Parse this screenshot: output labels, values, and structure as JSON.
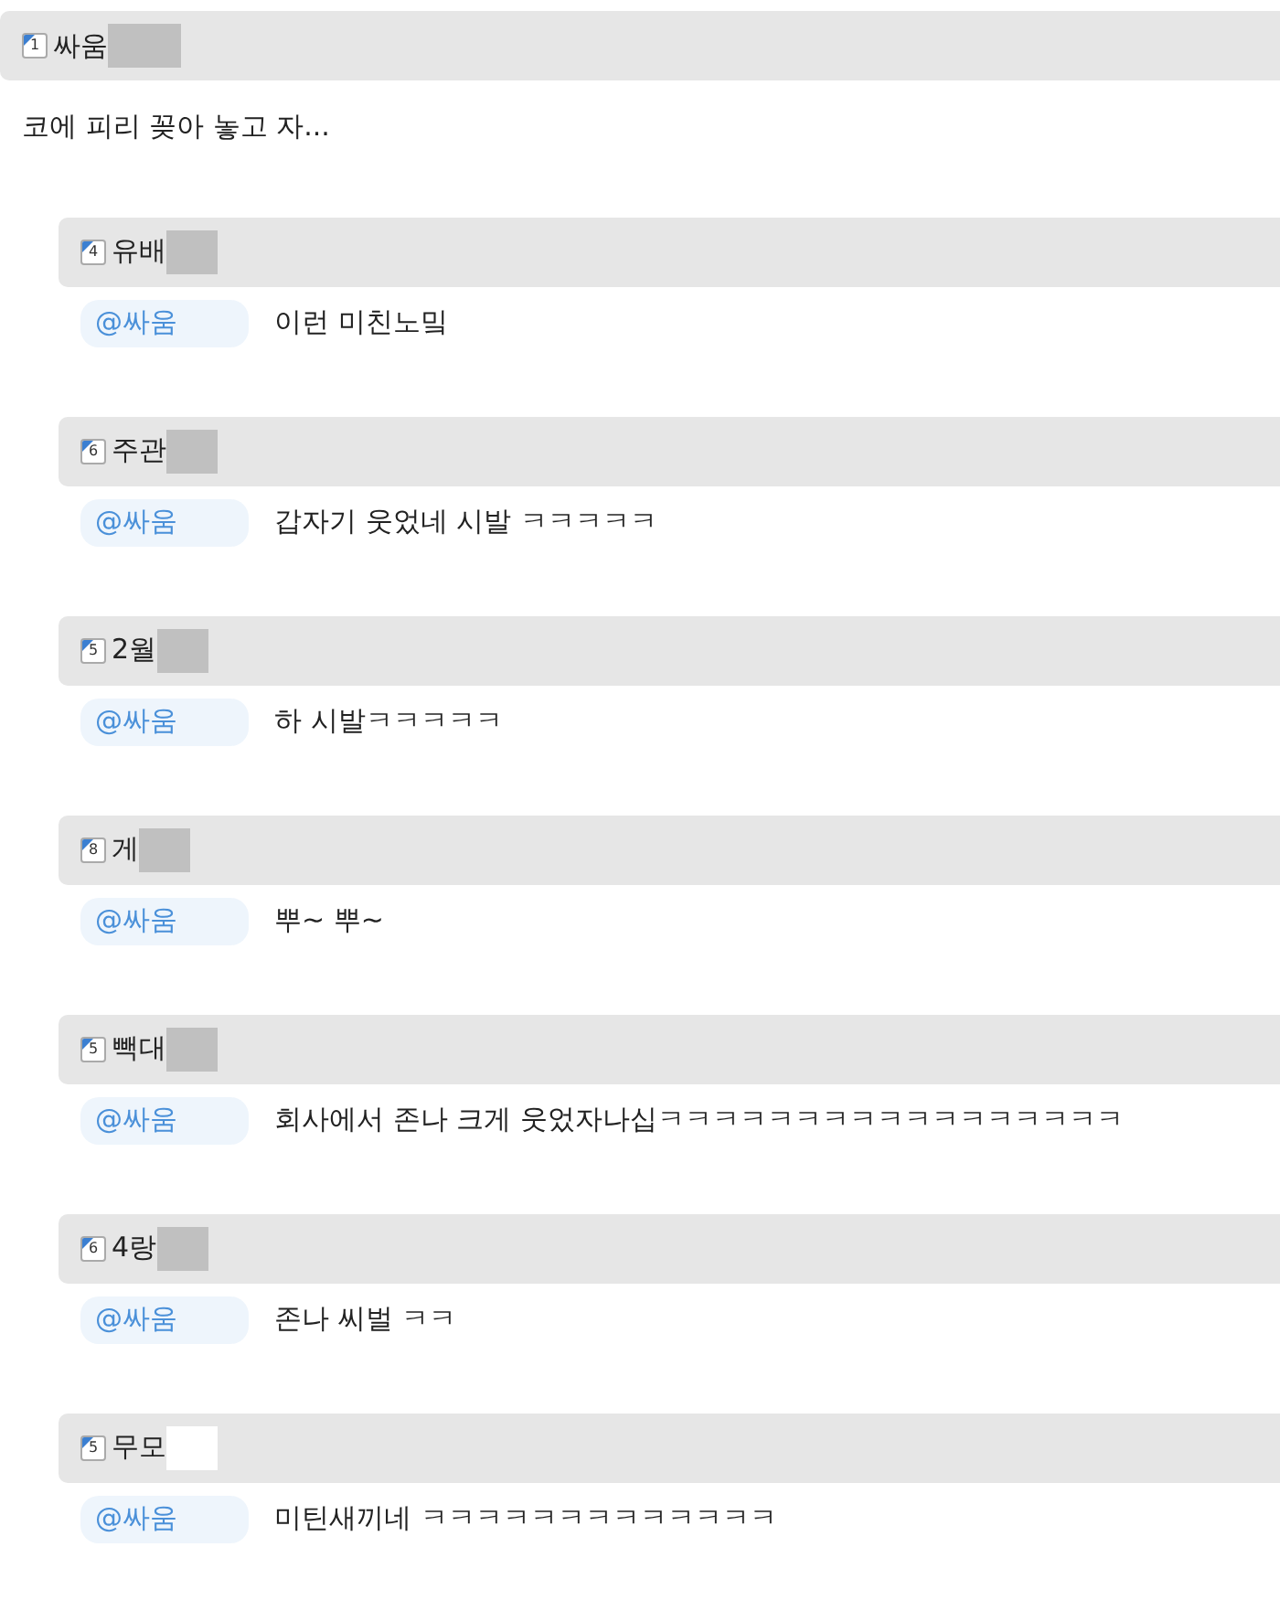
{
  "post": {
    "level": "1",
    "author": "싸움",
    "redacted": true,
    "text": "코에 피리 꽂아 놓고 자..."
  },
  "replies": [
    {
      "level": "4",
      "author": "유배",
      "redacted": true,
      "mention": "@싸움",
      "text": "이런 미친노밐"
    },
    {
      "level": "6",
      "author": "주관",
      "redacted": true,
      "mention": "@싸움",
      "text": "갑자기 웃었네 시발 ㅋㅋㅋㅋㅋ"
    },
    {
      "level": "5",
      "author": "2월",
      "redacted": true,
      "mention": "@싸움",
      "text": "하 시발ㅋㅋㅋㅋㅋ"
    },
    {
      "level": "8",
      "author": "게",
      "redacted": true,
      "mention": "@싸움",
      "text": "뿌~ 뿌~"
    },
    {
      "level": "5",
      "author": "빽대",
      "redacted": true,
      "mention": "@싸움",
      "text": "회사에서 존나 크게 웃었자나십ㅋㅋㅋㅋㅋㅋㅋㅋㅋㅋㅋㅋㅋㅋㅋㅋㅋ"
    },
    {
      "level": "6",
      "author": "4랑",
      "redacted": true,
      "mention": "@싸움",
      "text": "존나 씨벌 ㅋㅋ"
    },
    {
      "level": "5",
      "author": "무모",
      "redacted": false,
      "mention": "@싸움",
      "text": "미틴새끼네 ㅋㅋㅋㅋㅋㅋㅋㅋㅋㅋㅋㅋㅋ"
    }
  ]
}
